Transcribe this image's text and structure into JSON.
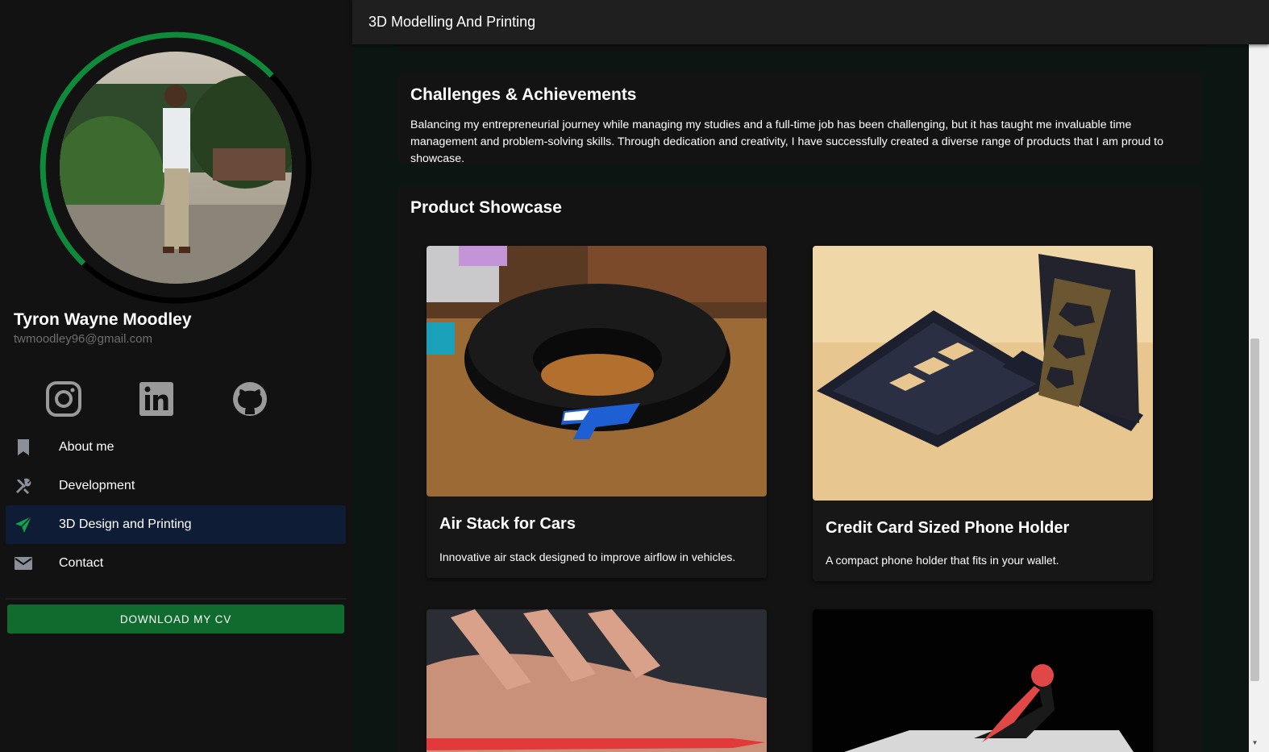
{
  "header": {
    "title": "3D Modelling And Printing"
  },
  "profile": {
    "name": "Tyron Wayne Moodley",
    "email": "twmoodley96@gmail.com"
  },
  "socials": [
    {
      "icon": "instagram-icon"
    },
    {
      "icon": "linkedin-icon"
    },
    {
      "icon": "github-icon"
    }
  ],
  "nav": [
    {
      "label": "About me",
      "icon": "bookmark-icon",
      "active": false
    },
    {
      "label": "Development",
      "icon": "tools-icon",
      "active": false
    },
    {
      "label": "3D Design and Printing",
      "icon": "send-icon",
      "active": true
    },
    {
      "label": "Contact",
      "icon": "mail-icon",
      "active": false
    }
  ],
  "cv_button": "DOWNLOAD MY CV",
  "challenges": {
    "title": "Challenges & Achievements",
    "text": "Balancing my entrepreneurial journey while managing my studies and a full-time job has been challenging, but it has taught me invaluable time management and problem-solving skills. Through dedication and creativity, I have successfully created a diverse range of products that I am proud to showcase."
  },
  "showcase": {
    "title": "Product Showcase",
    "products": [
      {
        "title": "Air Stack for Cars",
        "description": "Innovative air stack designed to improve airflow in vehicles."
      },
      {
        "title": "Credit Card Sized Phone Holder",
        "description": "A compact phone holder that fits in your wallet."
      }
    ]
  },
  "colors": {
    "accent_green": "#0f6b2e",
    "active_nav": "#0f1c36",
    "sidebar_bg": "#121212",
    "main_bg": "#0b1512"
  }
}
